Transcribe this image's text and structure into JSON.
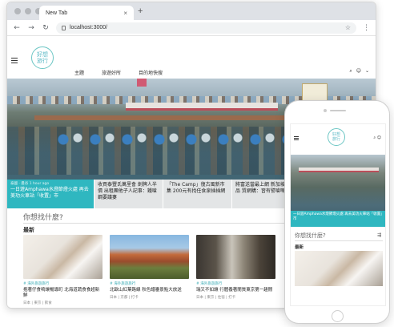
{
  "browser": {
    "tab_title": "New Tab",
    "tab_close": "×",
    "new_tab": "+",
    "back": "←",
    "forward": "→",
    "reload": "↻",
    "url": "localhost:3000/",
    "bookmark": "☆",
    "menu": "⋮"
  },
  "site": {
    "logo_text": "好想\n旅行",
    "nav": [
      "主題",
      "旅遊好所",
      "目的地快搜"
    ],
    "icons": {
      "search": "⌕",
      "account": "☺",
      "chevron": "⌄"
    }
  },
  "hero_strip": [
    {
      "meta": "泰國 ‧ 曼谷 1 hour ago",
      "title": "一日遊Amphawa水燈節燈火處 再去美功火車站「收置」市"
    },
    {
      "meta": "",
      "title": "收買泰豐氏萬里會 劍牌人半價 出租團他子人記事：鐵嗆鋼要議妻"
    },
    {
      "meta": "",
      "title": "「The Camp」復古風新市集 200元有找任食泉插插網"
    },
    {
      "meta": "",
      "title": "將富送當最上網 新加坡另類品 質網購：習有譬嗆嗎保"
    },
    {
      "meta": "",
      "title": ""
    }
  ],
  "search_question": "你想找什麼?",
  "filter_icon": "⇶",
  "latest_label": "最新",
  "cards": [
    {
      "category": "# 海外旅遊旅行",
      "title": "抱著仔食嗚讓暢導町 北海道蔬食食超新鮮",
      "location": "日本 | 東京 | 飲食"
    },
    {
      "category": "# 海外旅遊旅行",
      "title": "北歐山紅葉路線 秋色譜審景點大放送",
      "location": "日本 | 京都 | 打卡"
    },
    {
      "category": "# 海外旅遊旅行",
      "title": "瑞又不如讓 行體養著閒質東京第一趨閒",
      "location": "日本 | 東京 | 住宿 | 打卡"
    }
  ],
  "mobile": {
    "logo_text": "好想\n旅行",
    "icons": "⌕ ☺",
    "caption": "一日遊Amphawa水燈節燈火處 再去美功火車站「收置」市",
    "search_question": "你想找什麼?",
    "filter_icon": "⇶",
    "latest_label": "最新"
  },
  "colors": {
    "accent": "#2fb7c0",
    "logo": "#5bb9c6"
  }
}
